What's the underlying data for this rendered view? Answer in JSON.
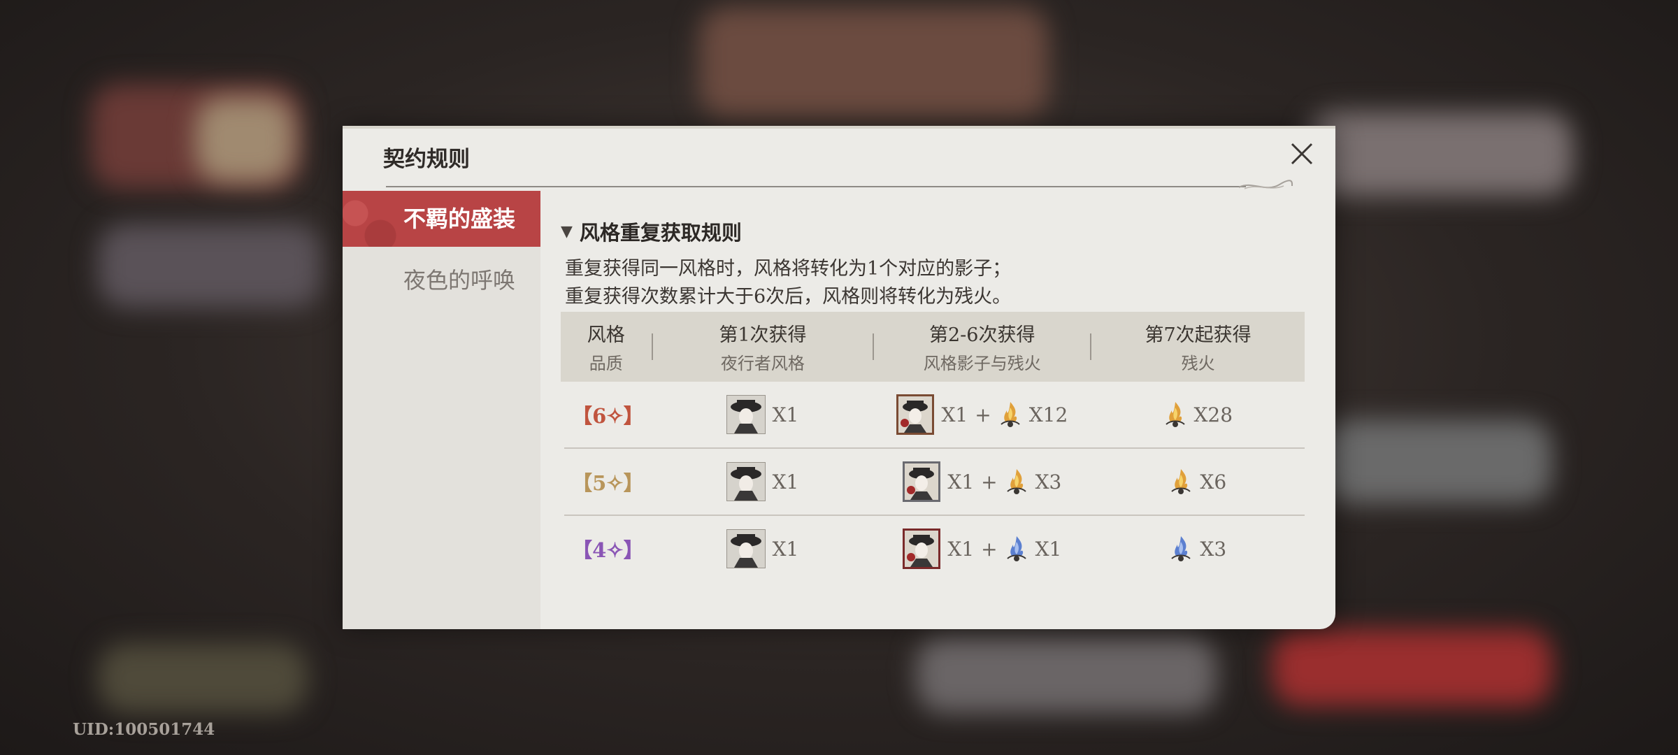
{
  "uid": "UID:100501744",
  "dialog": {
    "title": "契约规则",
    "close_icon": "close-icon"
  },
  "tabs": [
    {
      "label": "不羁的盛装",
      "active": true
    },
    {
      "label": "夜色的呼唤",
      "active": false
    }
  ],
  "section": {
    "title": "风格重复获取规则",
    "rules": [
      "重复获得同一风格时，风格将转化为1个对应的影子；",
      "重复获得次数累计大于6次后，风格则将转化为残火。"
    ]
  },
  "table": {
    "headers": [
      {
        "l1": "风格",
        "l2": "品质"
      },
      {
        "l1": "第1次获得",
        "l2": "夜行者风格"
      },
      {
        "l1": "第2-6次获得",
        "l2": "风格影子与残火"
      },
      {
        "l1": "第7次起获得",
        "l2": "残火"
      }
    ],
    "plus": "+",
    "rows": [
      {
        "quality": "【6✧】",
        "quality_color": "#c0543e",
        "first": "X1",
        "shadow": "X1",
        "ember_mid": "X12",
        "ember_last": "X28",
        "ember_color": "gold"
      },
      {
        "quality": "【5✧】",
        "quality_color": "#b8955a",
        "first": "X1",
        "shadow": "X1",
        "ember_mid": "X3",
        "ember_last": "X6",
        "ember_color": "gold"
      },
      {
        "quality": "【4✧】",
        "quality_color": "#8a55b5",
        "first": "X1",
        "shadow": "X1",
        "ember_mid": "X1",
        "ember_last": "X3",
        "ember_color": "blue"
      }
    ]
  }
}
